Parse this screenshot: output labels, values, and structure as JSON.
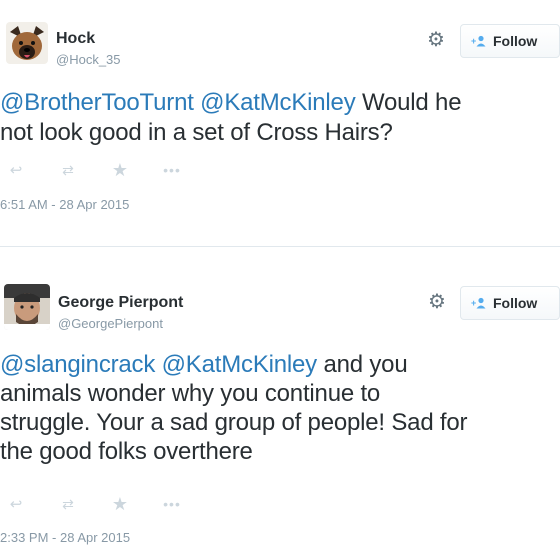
{
  "tweets": [
    {
      "display_name": "Hock",
      "handle": "@Hock_35",
      "follow_label": "Follow",
      "text_parts": [
        {
          "text": "@BrotherTooTurnt",
          "type": "mention"
        },
        {
          "text": " ",
          "type": "plain"
        },
        {
          "text": "@KatMcKinley",
          "type": "mention"
        },
        {
          "text": " Would he",
          "type": "plain"
        }
      ],
      "text_line2": "not look good in a set of Cross Hairs?",
      "timestamp": "6:51 AM - 28 Apr 2015"
    },
    {
      "display_name": "George Pierpont",
      "handle": "@GeorgePierpont",
      "follow_label": "Follow",
      "text_parts": [
        {
          "text": "@slangincrack",
          "type": "mention"
        },
        {
          "text": " ",
          "type": "plain"
        },
        {
          "text": "@KatMcKinley",
          "type": "mention"
        },
        {
          "text": " and you",
          "type": "plain"
        }
      ],
      "text_line2": "animals wonder why you continue to",
      "text_line3": "struggle. Your a sad group of people! Sad for",
      "text_line4": "the good folks overthere",
      "timestamp": "2:33 PM - 28 Apr 2015"
    }
  ],
  "icons": {
    "gear": "gear-icon",
    "follow": "add-user-icon",
    "reply": "reply-icon",
    "retweet": "retweet-icon",
    "favorite": "star-icon",
    "more": "more-icon"
  },
  "colors": {
    "mention": "#2b7bb9",
    "follow_icon": "#55acee",
    "muted": "#8899a6",
    "action": "#ccd6dd"
  }
}
